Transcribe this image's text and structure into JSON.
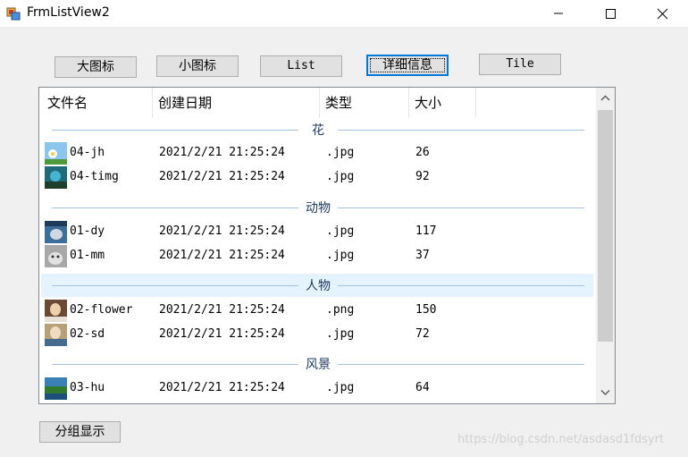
{
  "window": {
    "title": "FrmListView2"
  },
  "toolbar": {
    "large_icon": "大图标",
    "small_icon": "小图标",
    "list": "List",
    "details": "详细信息",
    "tile": "Tile"
  },
  "listview": {
    "columns": [
      "文件名",
      "创建日期",
      "类型",
      "大小"
    ],
    "groups": [
      {
        "name": "花",
        "items": [
          {
            "name": "04-jh",
            "date": "2021/2/21 21:25:24",
            "type": ".jpg",
            "size": "26"
          },
          {
            "name": "04-timg",
            "date": "2021/2/21 21:25:24",
            "type": ".jpg",
            "size": "92"
          }
        ]
      },
      {
        "name": "动物",
        "items": [
          {
            "name": "01-dy",
            "date": "2021/2/21 21:25:24",
            "type": ".jpg",
            "size": "117"
          },
          {
            "name": "01-mm",
            "date": "2021/2/21 21:25:24",
            "type": ".jpg",
            "size": "37"
          }
        ]
      },
      {
        "name": "人物",
        "items": [
          {
            "name": "02-flower",
            "date": "2021/2/21 21:25:24",
            "type": ".png",
            "size": "150"
          },
          {
            "name": "02-sd",
            "date": "2021/2/21 21:25:24",
            "type": ".jpg",
            "size": "72"
          }
        ]
      },
      {
        "name": "风景",
        "items": [
          {
            "name": "03-hu",
            "date": "2021/2/21 21:25:24",
            "type": ".jpg",
            "size": "64"
          }
        ]
      }
    ]
  },
  "group_toggle_label": "分组显示",
  "watermark": "https://blog.csdn.net/asdasd1fdsyrt",
  "colors": {
    "group_text": "#1e395b",
    "group_line": "#a6c1de",
    "hover_group": "#e5f3ff",
    "focus_border": "#0078d7"
  }
}
